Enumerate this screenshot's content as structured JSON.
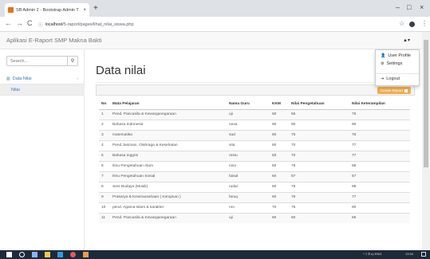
{
  "browser": {
    "tab_title": "SB Admin 2 - Bootstrap Admin T",
    "tab_close": "×",
    "new_tab": "+",
    "minimize": "–",
    "maximize": "□",
    "close": "×",
    "back": "←",
    "forward": "→",
    "reload": "C",
    "info": "ⓘ",
    "url_host": "localhost",
    "url_path": "/5-raport/pages/lihat_nilai_siswa.php",
    "star": "☆",
    "menu": "⋮"
  },
  "navbar": {
    "brand": "Aplikasi E-Raport SMP Makna Bakti",
    "user_icon": "▲▾"
  },
  "sidebar": {
    "search_placeholder": "Search...",
    "search_icon": "⚲",
    "items": [
      {
        "label": "Data Nilai",
        "chevron": "‹"
      },
      {
        "label": "Nilai"
      }
    ]
  },
  "main": {
    "title": "Data nilai",
    "create_button": "Create Report"
  },
  "table": {
    "headers": [
      "No",
      "Mata Pelajaran",
      "Nama Guru",
      "KKM",
      "Nilai Pengetahuan",
      "Nilai Keterampilan"
    ],
    "rows": [
      [
        "1",
        "Pend. Pancasila & Kewarganegaraan",
        "uji",
        "60",
        "65",
        "75"
      ],
      [
        "2",
        "Bahasa Indonesia",
        "nova",
        "90",
        "90",
        "90"
      ],
      [
        "3",
        "matematika",
        "sad",
        "60",
        "75",
        "76"
      ],
      [
        "4",
        "Pend.Jasmani, Olahraga & Kesehatan",
        "vita",
        "60",
        "70",
        "77"
      ],
      [
        "5",
        "Bahasa Inggris",
        "restu",
        "60",
        "70",
        "77"
      ],
      [
        "6",
        "Ilmu Pengetahuan Alam",
        "nino",
        "60",
        "78",
        "86"
      ],
      [
        "7",
        "Ilmu Pengetahuan Sosial",
        "faisal",
        "60",
        "87",
        "67"
      ],
      [
        "8",
        "Seni Budaya (Musik)",
        "rudal",
        "60",
        "78",
        "98"
      ],
      [
        "9",
        "Prakarya & Kewirausahaan ( Kerajinan )",
        "faruq",
        "60",
        "76",
        "77"
      ],
      [
        "10",
        "pend. Agama Islam & karakter",
        "nro",
        "70",
        "75",
        "80"
      ],
      [
        "11",
        "Pend. Pancasila & Kewarganegaraan",
        "uji",
        "60",
        "60",
        "65"
      ]
    ]
  },
  "dropdown": {
    "items": [
      {
        "icon": "👤",
        "label": "User Profile"
      },
      {
        "icon": "⚙",
        "label": "Settings"
      },
      {
        "icon": "⇥",
        "label": "Logout"
      }
    ]
  },
  "taskbar": {
    "tray_text": "^ ᛒ ✉ ⊃) ENG",
    "time": "13:34"
  },
  "colors": {
    "accent": "#337ab7",
    "warning": "#f0ad4e"
  }
}
